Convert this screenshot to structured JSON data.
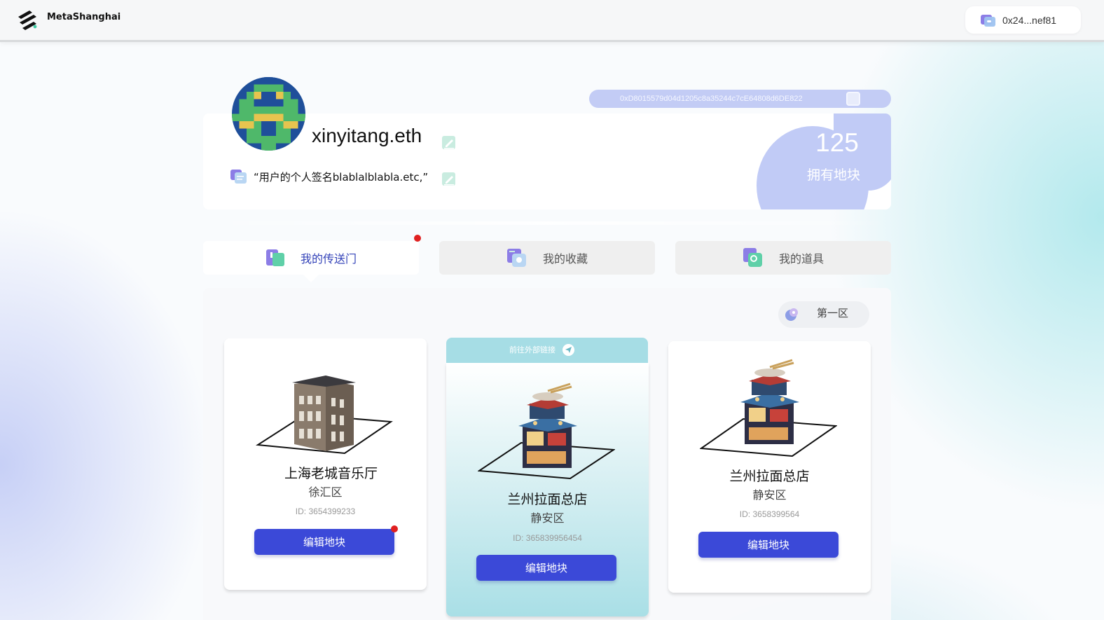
{
  "header": {
    "brand": "MetaShanghai",
    "wallet_label": "0x24...nef81"
  },
  "profile": {
    "address": "0xD8015579d04d1205c8a35244c7cE64808d6DE822",
    "username": "xinyitang.eth",
    "signature": "“用户的个人签名blablalblabla.etc,”",
    "stat_value": "125",
    "stat_label": "拥有地块"
  },
  "tabs": [
    {
      "label": "我的传送门",
      "icon": "portal-icon",
      "active": true
    },
    {
      "label": "我的收藏",
      "icon": "collection-icon",
      "active": false
    },
    {
      "label": "我的道具",
      "icon": "props-icon",
      "active": false
    }
  ],
  "filter": {
    "district": "第一区"
  },
  "cards": [
    {
      "title": "上海老城音乐厅",
      "district": "徐汇区",
      "id": "ID: 3654399233",
      "button": "编辑地块"
    },
    {
      "title": "兰州拉面总店",
      "district": "静安区",
      "id": "ID: 365839956454",
      "button": "编辑地块",
      "external_link": "前往外部链接"
    },
    {
      "title": "兰州拉面总店",
      "district": "静安区",
      "id": "ID: 3658399564",
      "button": "编辑地块"
    }
  ],
  "colors": {
    "accent": "#3b49d8",
    "pill": "#c3ccf5",
    "highlight_card": "#a6dde5",
    "notification": "#e02020"
  }
}
